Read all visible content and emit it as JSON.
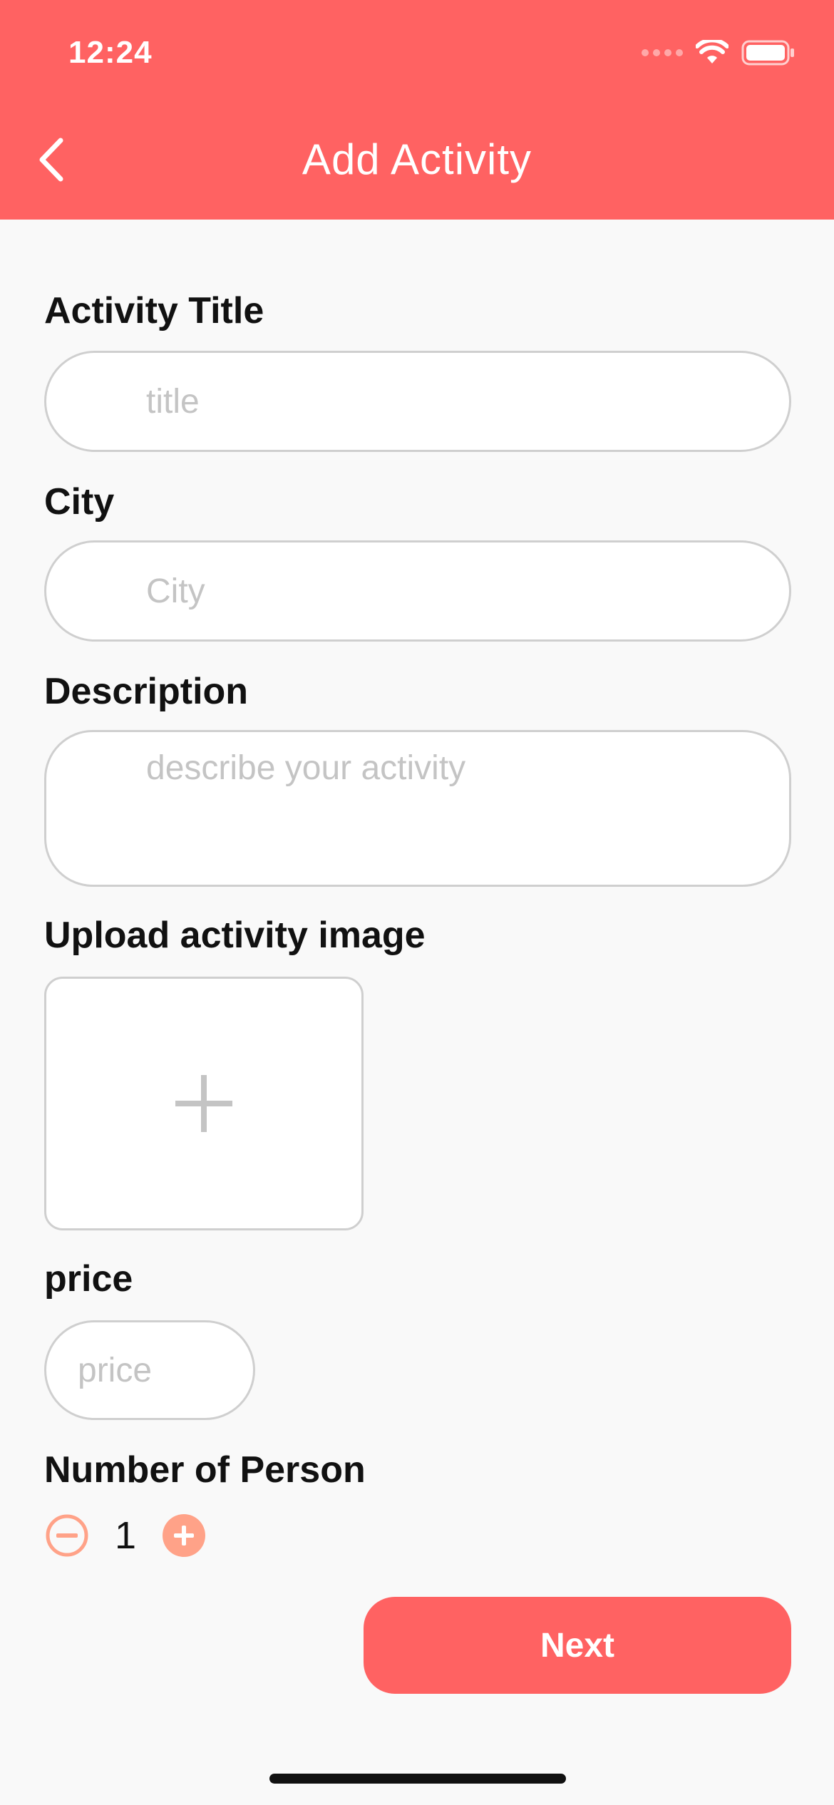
{
  "status_bar": {
    "time": "12:24"
  },
  "nav": {
    "title": "Add Activity",
    "back_icon": "chevron-left-icon"
  },
  "form": {
    "title": {
      "label": "Activity Title",
      "placeholder": "title",
      "value": ""
    },
    "city": {
      "label": "City",
      "placeholder": "City",
      "value": ""
    },
    "description": {
      "label": "Description",
      "placeholder": "describe your activity",
      "value": ""
    },
    "image": {
      "label": "Upload activity image",
      "icon": "plus-icon"
    },
    "price": {
      "label": "price",
      "placeholder": "price",
      "value": ""
    },
    "persons": {
      "label": "Number of Person",
      "count": "1",
      "decrement_icon": "minus-circle-icon",
      "increment_icon": "plus-circle-icon"
    }
  },
  "actions": {
    "next_label": "Next"
  },
  "colors": {
    "primary": "#ff6262",
    "stepper_accent": "#ffa288",
    "background": "#f9f9f9",
    "field_border": "#cfcfcf",
    "placeholder": "#c4c4c4"
  }
}
